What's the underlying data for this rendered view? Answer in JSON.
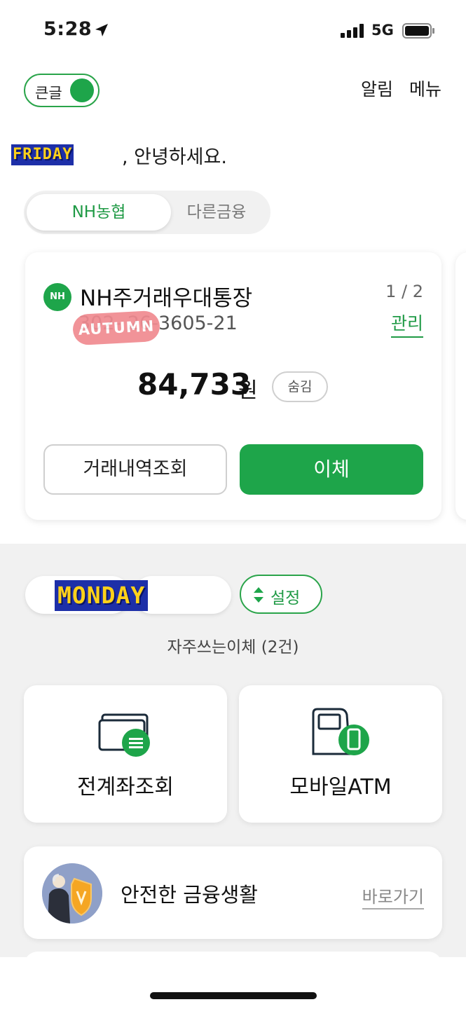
{
  "status_bar": {
    "time": "5:28",
    "network": "5G"
  },
  "header": {
    "big_text_toggle_label": "큰글",
    "notifications_label": "알림",
    "menu_label": "메뉴"
  },
  "greeting": {
    "name_sticker": "FRIDAY",
    "text": ", 안녕하세요."
  },
  "tabs": [
    {
      "label": "NH농협",
      "active": true
    },
    {
      "label": "다른금융",
      "active": false
    }
  ],
  "account_card": {
    "logo_text": "NH",
    "name": "NH주거래우대통장",
    "number": "302-  26-3605-21",
    "sticker": "AUTUMN",
    "page_indicator": "1 / 2",
    "manage_label": "관리",
    "balance": "84,733",
    "balance_unit": "원",
    "hide_label": "숨김",
    "history_button": "거래내역조회",
    "transfer_button": "이체"
  },
  "quick_transfer": {
    "sticker": "MONDAY",
    "settings_label": "설정",
    "frequent_label": "자주쓰는이체 (2건)"
  },
  "tiles": [
    {
      "label": "전계좌조회",
      "icon": "cards-icon"
    },
    {
      "label": "모바일ATM",
      "icon": "atm-phone-icon"
    }
  ],
  "promo": {
    "title": "안전한 금융생활",
    "link_label": "바로가기"
  },
  "colors": {
    "accent": "#1ea54a",
    "accent_text": "#1f9a45",
    "section_bg": "#f1f1f1"
  }
}
